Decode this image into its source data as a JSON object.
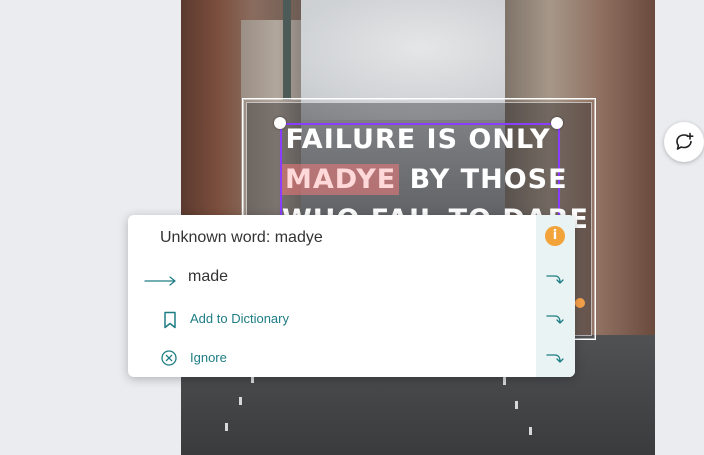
{
  "canvas": {
    "headline_lines": [
      "FAILURE IS ONLY",
      "BY THOSE",
      "WHO FAIL TO DARE"
    ],
    "misspelled_word": "MADYE"
  },
  "spell_popup": {
    "title": "Unknown word: madye",
    "suggestion": "made",
    "add_to_dictionary": "Add to Dictionary",
    "ignore": "Ignore",
    "info_icon": "i"
  },
  "icons": {
    "comment": "comment-plus-icon",
    "arrow": "arrow-right-icon",
    "bookmark": "bookmark-icon",
    "ignore": "x-circle-icon",
    "apply": "apply-arrow-icon"
  },
  "colors": {
    "selection": "#8b3dff",
    "accent": "#1e7d84",
    "info": "#f2a33a"
  }
}
